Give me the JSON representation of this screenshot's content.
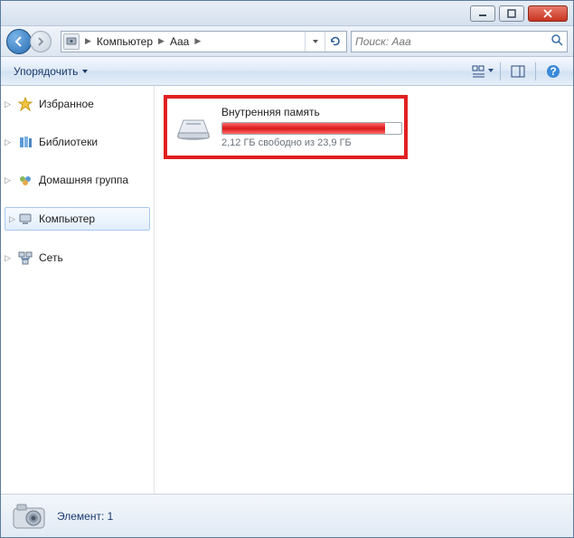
{
  "breadcrumb": {
    "item1": "Компьютер",
    "item2": "Aaa"
  },
  "search": {
    "placeholder": "Поиск: Aaa"
  },
  "toolbar": {
    "organize": "Упорядочить"
  },
  "sidebar": {
    "favorites": "Избранное",
    "libraries": "Библиотеки",
    "homegroup": "Домашняя группа",
    "computer": "Компьютер",
    "network": "Сеть"
  },
  "drive": {
    "name": "Внутренняя память",
    "free_text": "2,12 ГБ свободно из 23,9 ГБ",
    "usage_percent": 91
  },
  "status": {
    "elements": "Элемент: 1"
  },
  "colors": {
    "highlight": "#e02020",
    "usage_fill": "#d81818"
  }
}
